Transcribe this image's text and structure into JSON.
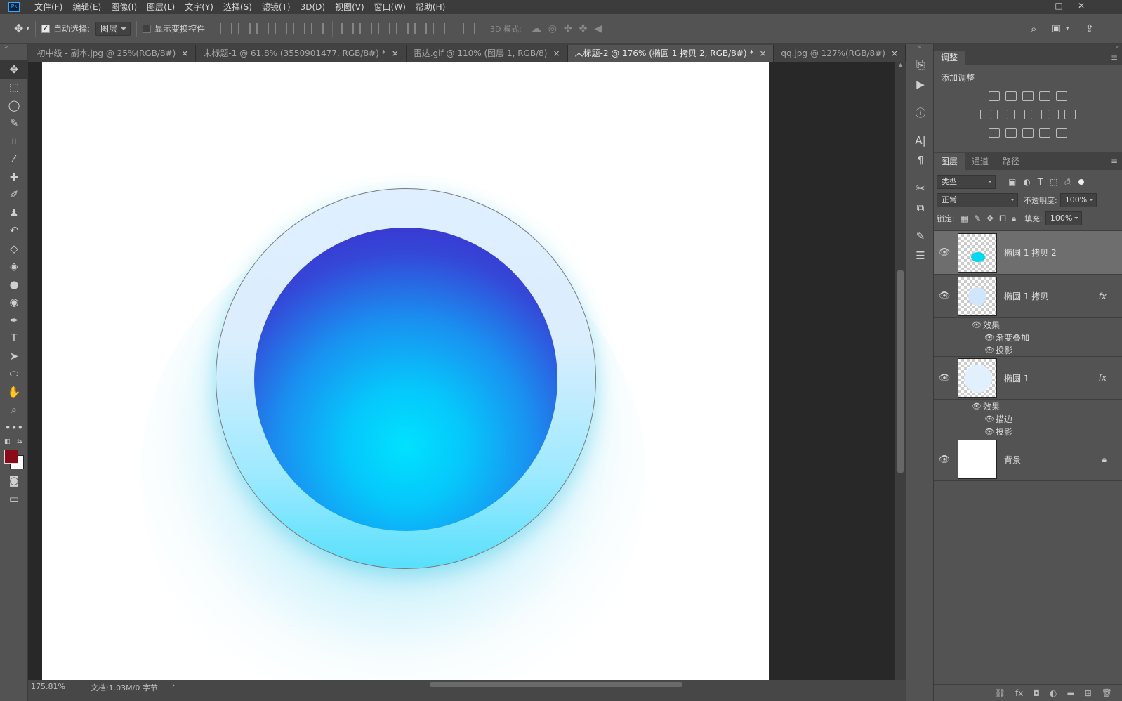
{
  "menubar": {
    "logo": "Ps",
    "items": [
      "文件(F)",
      "编辑(E)",
      "图像(I)",
      "图层(L)",
      "文字(Y)",
      "选择(S)",
      "滤镜(T)",
      "3D(D)",
      "视图(V)",
      "窗口(W)",
      "帮助(H)"
    ],
    "window_controls": [
      "—",
      "□",
      "✕"
    ]
  },
  "options": {
    "auto_select_label": "自动选择:",
    "auto_select_value": "图层",
    "show_transform_label": "显示变换控件",
    "mode_3d_label": "3D 模式:"
  },
  "tabs": [
    {
      "label": "初中级 - 副本.jpg @ 25%(RGB/8#)",
      "close": "×"
    },
    {
      "label": "未标题-1 @ 61.8% (3550901477, RGB/8#) *",
      "close": "×"
    },
    {
      "label": "雷达.gif @ 110% (图层 1, RGB/8)",
      "close": "×"
    },
    {
      "label": "未标题-2 @ 176% (椭圆 1 拷贝 2, RGB/8#) *",
      "close": "×"
    },
    {
      "label": "qq.jpg @ 127%(RGB/8#)",
      "close": "×"
    }
  ],
  "status": {
    "zoom": "175.81%",
    "doc": "文档:1.03M/0 字节"
  },
  "adjustments": {
    "tab": "调整",
    "add_label": "添加调整"
  },
  "layers_panel": {
    "tabs": [
      "图层",
      "通道",
      "路径"
    ],
    "filter_kind": "类型",
    "blend_mode": "正常",
    "opacity_label": "不透明度:",
    "opacity_value": "100%",
    "lock_label": "锁定:",
    "fill_label": "填充:",
    "fill_value": "100%",
    "layers": [
      {
        "name": "椭圆 1 拷贝 2",
        "selected": true
      },
      {
        "name": "椭圆 1 拷贝",
        "fx": "fx",
        "effects_label": "效果",
        "effects": [
          "渐变叠加",
          "投影"
        ]
      },
      {
        "name": "椭圆 1",
        "fx": "fx",
        "effects_label": "效果",
        "effects": [
          "描边",
          "投影"
        ]
      },
      {
        "name": "背景",
        "locked": true
      }
    ]
  },
  "colors": {
    "foreground": "#8b0a1a",
    "background": "#ffffff",
    "accent": "#31a8ff"
  }
}
